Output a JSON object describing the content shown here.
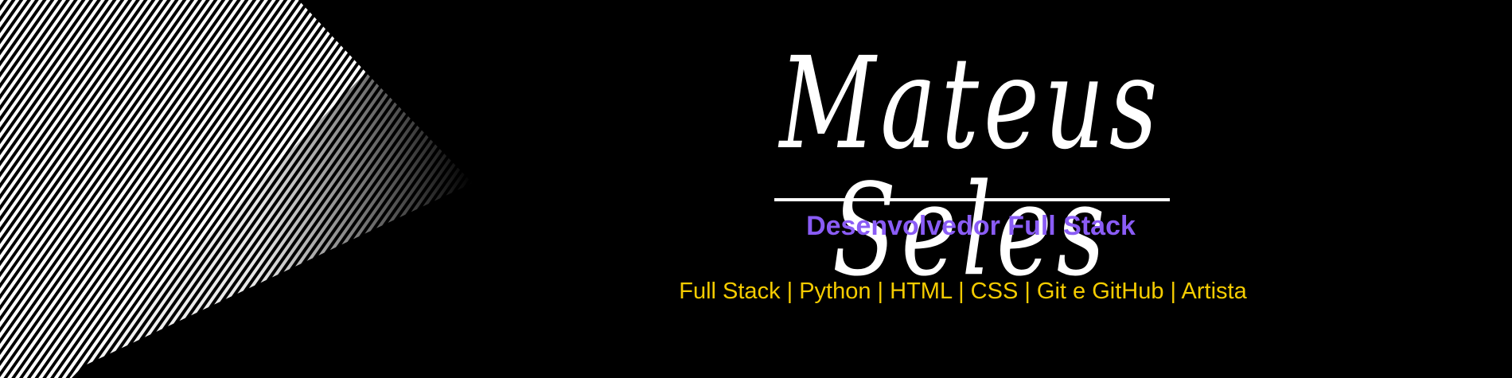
{
  "name": "Mateus Seles",
  "subtitle": "Desenvolvedor Full Stack",
  "skills": "Full Stack | Python | HTML | CSS | Git e GitHub | Artista",
  "colors": {
    "background": "#000000",
    "subtitle": "#8a5cf6",
    "skills": "#f5cc00",
    "name": "#ffffff"
  }
}
